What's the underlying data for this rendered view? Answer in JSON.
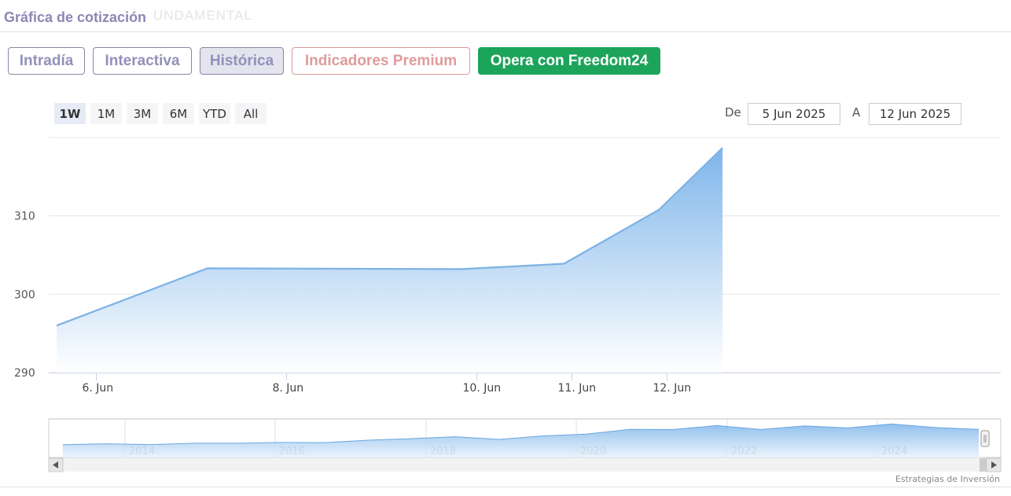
{
  "header": {
    "title": "Gráfica de cotización",
    "ghost_text": "UNDAMENTAL"
  },
  "tabs": [
    {
      "label": "Intradía",
      "state": "normal"
    },
    {
      "label": "Interactiva",
      "state": "normal"
    },
    {
      "label": "Histórica",
      "state": "active"
    },
    {
      "label": "Indicadores Premium",
      "state": "premium"
    },
    {
      "label": "Opera con Freedom24",
      "state": "cta"
    }
  ],
  "range_selector": {
    "buttons": [
      "1W",
      "1M",
      "3M",
      "6M",
      "YTD",
      "All"
    ],
    "selected": "1W",
    "from_label": "De",
    "from_value": "5 Jun 2025",
    "to_label": "A",
    "to_value": "12 Jun 2025"
  },
  "colors": {
    "line": "#7cb2e6",
    "area_top": "#7eb5ea",
    "area_bottom": "#ffffff",
    "cta": "#1da45b",
    "title": "#8e86b3"
  },
  "chart_data": {
    "type": "area",
    "x": [
      "2025-06-05T14:00",
      "2025-06-07T04:00",
      "2025-06-09T20:00",
      "2025-06-10T22:00",
      "2025-06-11T22:00",
      "2025-06-12T14:00"
    ],
    "values": [
      296,
      303.3,
      303.2,
      303.9,
      310.8,
      318.7
    ],
    "x_ticks": [
      "6. Jun",
      "8. Jun",
      "10. Jun",
      "11. Jun",
      "12. Jun"
    ],
    "x_tick_dates": [
      "2025-06-06",
      "2025-06-08",
      "2025-06-10",
      "2025-06-11",
      "2025-06-12"
    ],
    "y_ticks": [
      290,
      300,
      310
    ],
    "ylim": [
      290,
      320
    ],
    "grid": true,
    "title": "",
    "xlabel": "",
    "ylabel": ""
  },
  "navigator": {
    "year_labels": [
      "2014",
      "2016",
      "2018",
      "2020",
      "2022",
      "2024"
    ],
    "profile": [
      52,
      53,
      53,
      56,
      60,
      60,
      63,
      72,
      84,
      90,
      80,
      94,
      108,
      122,
      138,
      142,
      138,
      140,
      146,
      150,
      148,
      122
    ],
    "credit": "Estrategias de Inversión"
  }
}
